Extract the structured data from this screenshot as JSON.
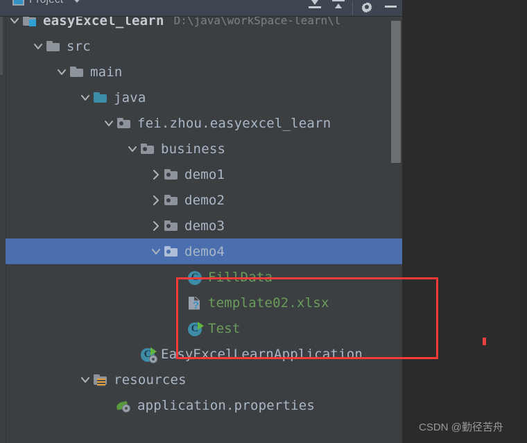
{
  "window": {
    "tool_window_title": "Project",
    "accent_selection": "#4b6eaf",
    "panel_bg": "#3c3f41",
    "header_bg": "#3c4550",
    "annotation_color": "#f63a37"
  },
  "toolbar": {
    "collapse_all_label": "collapse-all",
    "expand_all_label": "expand-all",
    "settings_label": "Settings",
    "hide_label": "Hide"
  },
  "tree": {
    "rows": [
      {
        "label": "easyExcel_learn",
        "path": "D:\\java\\workSpace-learn\\l",
        "icon": "project-folder-icon",
        "expanded": true,
        "indent": 0,
        "selected": false,
        "style": "bold"
      },
      {
        "label": "src",
        "path": "",
        "icon": "folder-icon",
        "expanded": true,
        "indent": 1,
        "selected": false,
        "style": "normal"
      },
      {
        "label": "main",
        "path": "",
        "icon": "folder-icon",
        "expanded": true,
        "indent": 2,
        "selected": false,
        "style": "normal"
      },
      {
        "label": "java",
        "path": "",
        "icon": "source-root-folder-icon",
        "expanded": true,
        "indent": 3,
        "selected": false,
        "style": "normal"
      },
      {
        "label": "fei.zhou.easyexcel_learn",
        "path": "",
        "icon": "package-folder-icon",
        "expanded": true,
        "indent": 4,
        "selected": false,
        "style": "normal"
      },
      {
        "label": "business",
        "path": "",
        "icon": "package-folder-icon",
        "expanded": true,
        "indent": 5,
        "selected": false,
        "style": "normal"
      },
      {
        "label": "demo1",
        "path": "",
        "icon": "package-folder-icon",
        "expanded": false,
        "indent": 6,
        "selected": false,
        "style": "normal"
      },
      {
        "label": "demo2",
        "path": "",
        "icon": "package-folder-icon",
        "expanded": false,
        "indent": 6,
        "selected": false,
        "style": "normal"
      },
      {
        "label": "demo3",
        "path": "",
        "icon": "package-folder-icon",
        "expanded": false,
        "indent": 6,
        "selected": false,
        "style": "normal"
      },
      {
        "label": "demo4",
        "path": "",
        "icon": "package-folder-icon",
        "expanded": true,
        "indent": 6,
        "selected": true,
        "style": "normal"
      },
      {
        "label": "FillData",
        "path": "",
        "icon": "java-class-icon",
        "expanded": null,
        "indent": 7,
        "selected": false,
        "style": "green"
      },
      {
        "label": "template02.xlsx",
        "path": "",
        "icon": "unknown-file-icon",
        "expanded": null,
        "indent": 7,
        "selected": false,
        "style": "green"
      },
      {
        "label": "Test",
        "path": "",
        "icon": "runnable-class-icon",
        "expanded": null,
        "indent": 7,
        "selected": false,
        "style": "green"
      },
      {
        "label": "EasyExcelLearnApplication",
        "path": "",
        "icon": "spring-boot-application-icon",
        "expanded": null,
        "indent": 5,
        "selected": false,
        "style": "normal"
      },
      {
        "label": "resources",
        "path": "",
        "icon": "resource-root-folder-icon",
        "expanded": true,
        "indent": 3,
        "selected": false,
        "style": "normal"
      },
      {
        "label": "application.properties",
        "path": "",
        "icon": "spring-properties-icon",
        "expanded": null,
        "indent": 4,
        "selected": false,
        "style": "normal"
      }
    ]
  },
  "watermark": {
    "text": "CSDN @勤径苦舟"
  }
}
